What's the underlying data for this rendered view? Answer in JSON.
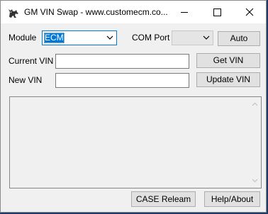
{
  "window": {
    "title": "GM VIN Swap - www.customecm.co...",
    "app_icon": "cat-icon",
    "controls": [
      "minimize-icon",
      "maximize-icon",
      "close-icon"
    ]
  },
  "module": {
    "label": "Module",
    "selected": "ECM"
  },
  "com_port": {
    "label": "COM Port",
    "selected": ""
  },
  "buttons": {
    "auto": "Auto",
    "get_vin": "Get VIN",
    "update_vin": "Update VIN",
    "case_relearn": "CASE Releam",
    "help_about": "Help/About"
  },
  "current_vin": {
    "label": "Current VIN",
    "value": ""
  },
  "new_vin": {
    "label": "New VIN",
    "value": ""
  },
  "log": {
    "content": ""
  },
  "colors": {
    "accent": "#0078d7",
    "window_bg": "#f0f0f0",
    "button_bg": "#e1e1e1"
  }
}
